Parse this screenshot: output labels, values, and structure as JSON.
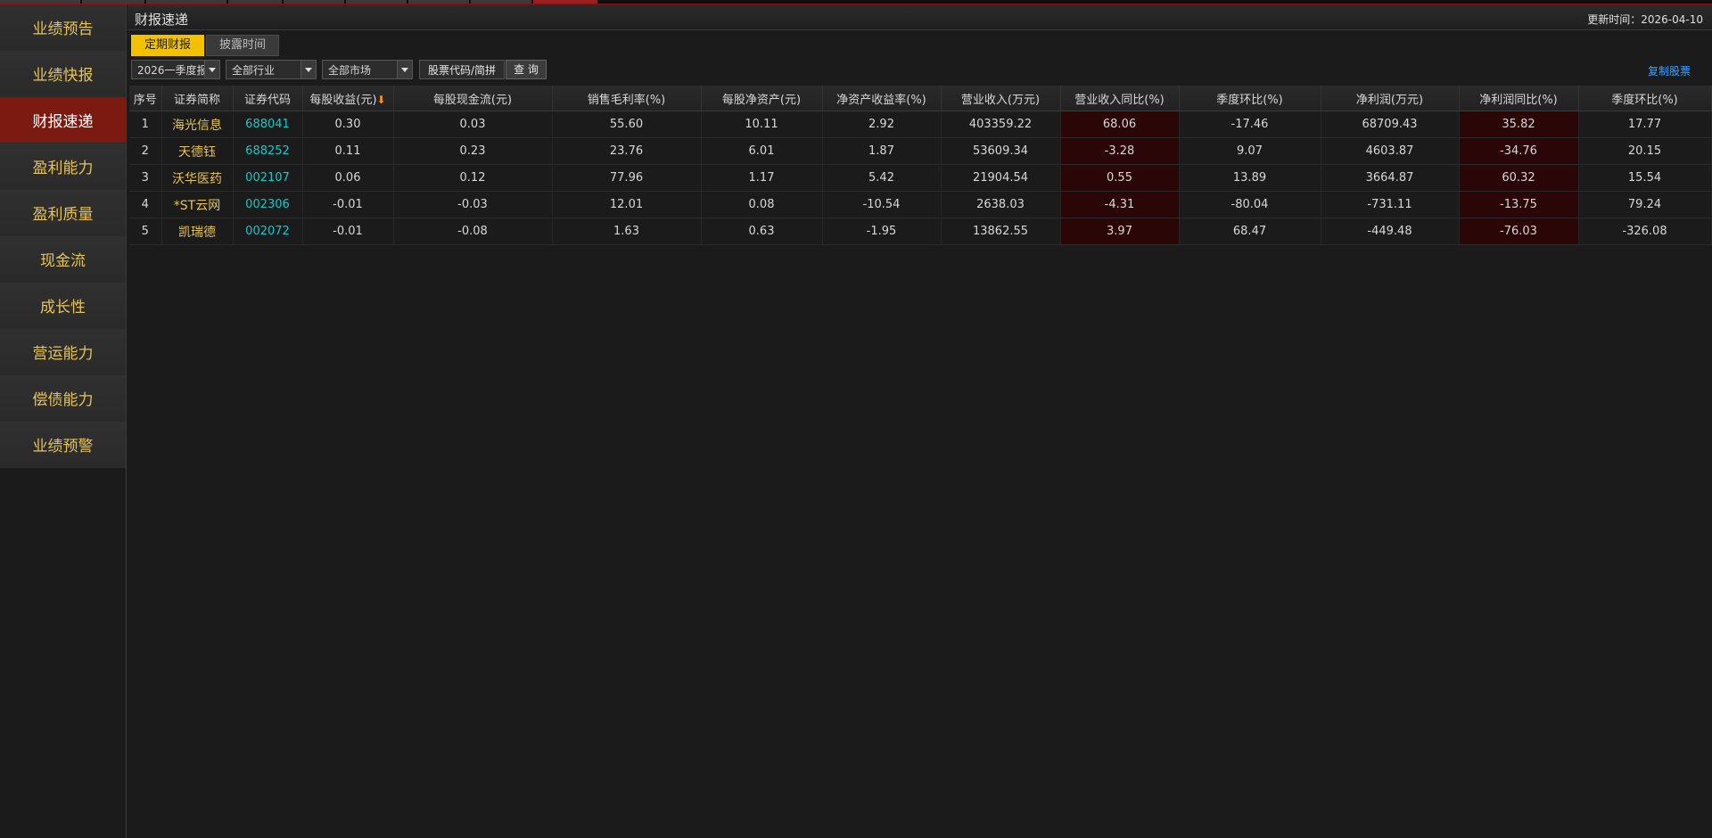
{
  "app": {
    "page_title": "财报速递",
    "update_label": "更新时间：",
    "update_date": "2026-04-10"
  },
  "sidebar": {
    "items": [
      {
        "label": "业绩预告"
      },
      {
        "label": "业绩快报"
      },
      {
        "label": "财报速递",
        "active": true
      },
      {
        "label": "盈利能力"
      },
      {
        "label": "盈利质量"
      },
      {
        "label": "现金流"
      },
      {
        "label": "成长性"
      },
      {
        "label": "营运能力"
      },
      {
        "label": "偿债能力"
      },
      {
        "label": "业绩预警"
      }
    ]
  },
  "tabs": [
    {
      "label": "定期财报",
      "active": true
    },
    {
      "label": "披露时间"
    }
  ],
  "filters": {
    "period": "2026一季度报",
    "industry": "全部行业",
    "market": "全部市场",
    "stock_placeholder": "股票代码/简拼",
    "query_label": "查 询",
    "copy_label": "复制股票"
  },
  "table": {
    "headers": [
      "序号",
      "证券简称",
      "证券代码",
      "每股收益(元)",
      "每股现金流(元)",
      "销售毛利率(%)",
      "每股净资产(元)",
      "净资产收益率(%)",
      "营业收入(万元)",
      "营业收入同比(%)",
      "季度环比(%)",
      "净利润(万元)",
      "净利润同比(%)",
      "季度环比(%)"
    ],
    "sort_arrow": "⬇",
    "rows": [
      [
        "1",
        "海光信息",
        "688041",
        "0.30",
        "0.03",
        "55.60",
        "10.11",
        "2.92",
        "403359.22",
        "68.06",
        "-17.46",
        "68709.43",
        "35.82",
        "17.77"
      ],
      [
        "2",
        "天德钰",
        "688252",
        "0.11",
        "0.23",
        "23.76",
        "6.01",
        "1.87",
        "53609.34",
        "-3.28",
        "9.07",
        "4603.87",
        "-34.76",
        "20.15"
      ],
      [
        "3",
        "沃华医药",
        "002107",
        "0.06",
        "0.12",
        "77.96",
        "1.17",
        "5.42",
        "21904.54",
        "0.55",
        "13.89",
        "3664.87",
        "60.32",
        "15.54"
      ],
      [
        "4",
        "*ST云网",
        "002306",
        "-0.01",
        "-0.03",
        "12.01",
        "0.08",
        "-10.54",
        "2638.03",
        "-4.31",
        "-80.04",
        "-731.11",
        "-13.75",
        "79.24"
      ],
      [
        "5",
        "凯瑞德",
        "002072",
        "-0.01",
        "-0.08",
        "1.63",
        "0.63",
        "-1.95",
        "13862.55",
        "3.97",
        "68.47",
        "-449.48",
        "-76.03",
        "-326.08"
      ]
    ]
  },
  "colors": {
    "accent_yellow": "#f2c200",
    "name_gold": "#e6c35a",
    "code_cyan": "#19c8c8",
    "active_sidebar": "#7a1a10",
    "link_blue": "#3aa0ff",
    "highlight_cell": "#2a0606"
  }
}
